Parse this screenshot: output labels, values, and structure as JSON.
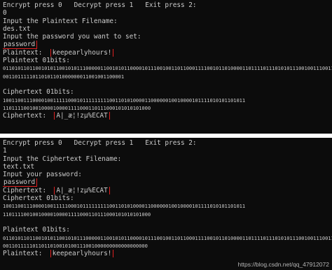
{
  "session1": {
    "menu": "Encrypt press 0   Decrypt press 1   Exit press 2:",
    "choice": "0",
    "filename_prompt": "Input the Plaintext Filename:",
    "filename": "des.txt",
    "password_prompt": "Input the password you want to set:",
    "password": "password",
    "plaintext_label": "Plaintext:",
    "plaintext_value": "keepearlyhours!",
    "plain_bits_label": "Plaintext 01bits:",
    "plain_bits_line1": "0110101101100101011001010111000001100101011000010111001001101100011110010110100001101111011101010111001001110011",
    "plain_bits_line2": "00110111110110101101000000011001001100001",
    "cipher_bits_label": "Ciphertext 01bits:",
    "cipher_bits_line1": "1001100111000010011111000101111111110011010100001100000010010000101111010101101011",
    "cipher_bits_line2": "11011110010010000100001111000110111000101010101000",
    "ciphertext_label": "Ciphertext:",
    "ciphertext_value": "Ä|_æ¦!zµ%ËCÄT"
  },
  "session2": {
    "menu": "Encrypt press 0   Decrypt press 1   Exit press 2:",
    "choice": "1",
    "filename_prompt": "Input the Ciphertext Filename:",
    "filename": "text.txt",
    "password_prompt": "Input your password:",
    "password": "password",
    "ciphertext_label": "Ciphertext:",
    "ciphertext_value": "Ä|_æ¦!zµ%ËCÄT",
    "cipher_bits_label": "Ciphertext 01bits:",
    "cipher_bits_line1": "1001100111000010011111000101111111110011010100001100000010010000101111010101101011",
    "cipher_bits_line2": "11011110010010000100001111000110111000101010101000",
    "plain_bits_label": "Plaintext 01bits:",
    "plain_bits_line1": "0110101101100101011001010111000001100101011000010111001001101100011110010110100001101111011101010111001001110011",
    "plain_bits_line2": "0011011111011011010010100111001000000000000000000",
    "plaintext_label": "Plaintext:",
    "plaintext_value": "keepearlyhours!"
  },
  "watermark": "https://blog.csdn.net/qq_47912072",
  "colors": {
    "terminal_bg": "#0c0c0c",
    "terminal_text": "#cccccc",
    "highlight_border": "#e02020",
    "page_bg": "#ffffff"
  }
}
